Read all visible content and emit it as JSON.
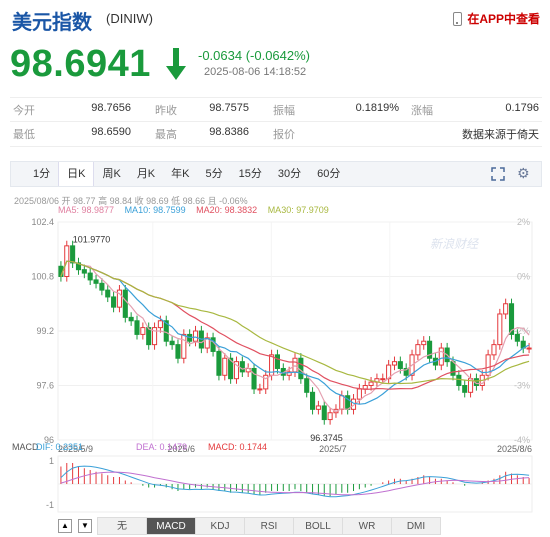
{
  "header": {
    "title": "美元指数",
    "code": "(DINIW)",
    "app_link": "在APP中查看",
    "price": "98.6941",
    "change": "-0.0634 (-0.0642%)",
    "timestamp": "2025-08-06 14:18:52"
  },
  "stats": [
    [
      {
        "label": "今开",
        "value": "98.7656"
      },
      {
        "label": "昨收",
        "value": "98.7575"
      },
      {
        "label": "振幅",
        "value": "0.1819%"
      },
      {
        "label": "涨幅",
        "value": "0.1796"
      }
    ],
    [
      {
        "label": "最低",
        "value": "98.6590"
      },
      {
        "label": "最高",
        "value": "98.8386"
      },
      {
        "label": "报价",
        "value": ""
      },
      {
        "label": "",
        "value": "数据来源于倚天"
      }
    ]
  ],
  "tabs": [
    "1分",
    "日K",
    "周K",
    "月K",
    "年K",
    "5分",
    "15分",
    "30分",
    "60分"
  ],
  "active_tab": "日K",
  "chart_info": {
    "line1": "2025/08/06 开 98.77 高 98.84 收 98.69 低 98.66 且 -0.06%",
    "ma5": "MA5: 98.9877",
    "ma10": "MA10: 98.7599",
    "ma20": "MA20: 98.3832",
    "ma30": "MA30: 97.9709",
    "watermark": "新浪财经"
  },
  "macd_info": {
    "label": "MACD",
    "dif": "DIF: 0.2351",
    "dea": "DEA: 0.1479",
    "macd": "MACD: 0.1744"
  },
  "bottom_tabs": [
    "无",
    "MACD",
    "KDJ",
    "RSI",
    "BOLL",
    "WR",
    "DMI"
  ],
  "active_bottom": "MACD",
  "colors": {
    "up": "#e4393c",
    "down": "#1a9a3c",
    "ma5": "#e4a0b0",
    "ma10": "#3aa0d8",
    "ma20": "#e05060",
    "ma30": "#a8b840"
  },
  "chart_data": {
    "type": "candlestick",
    "y_ticks": [
      "102.4",
      "100.8",
      "99.2",
      "97.6",
      "96"
    ],
    "y_right_ticks": [
      "2%",
      "0%",
      "-2%",
      "-3%",
      "-4%"
    ],
    "x_labels": [
      "2025/5/9",
      "2025/6",
      "2025/7",
      "2025/8/6"
    ],
    "annotations": [
      "101.9770",
      "96.3745"
    ],
    "ylim": [
      96,
      102.4
    ],
    "close": [
      100.8,
      101.7,
      101.2,
      101.0,
      100.9,
      100.7,
      100.6,
      100.4,
      100.2,
      99.9,
      100.4,
      99.6,
      99.5,
      99.1,
      99.3,
      98.8,
      99.3,
      99.5,
      98.9,
      98.8,
      98.4,
      99.1,
      98.9,
      99.2,
      98.7,
      99.0,
      98.6,
      97.9,
      98.4,
      97.8,
      98.3,
      98.0,
      98.1,
      97.5,
      97.5,
      97.9,
      98.5,
      98.1,
      97.9,
      98.0,
      98.4,
      97.8,
      97.4,
      96.9,
      97.0,
      96.6,
      96.8,
      96.9,
      97.3,
      96.9,
      97.2,
      97.5,
      97.6,
      97.7,
      97.8,
      97.8,
      98.2,
      98.3,
      98.1,
      97.9,
      98.5,
      98.8,
      98.9,
      98.4,
      98.2,
      98.7,
      98.3,
      97.9,
      97.6,
      97.4,
      97.8,
      97.6,
      97.9,
      98.5,
      98.8,
      99.7,
      100.0,
      99.1,
      98.9,
      98.7,
      98.7
    ],
    "macd_hist": [
      0.5,
      0.6,
      0.6,
      0.5,
      0.45,
      0.4,
      0.35,
      0.3,
      0.25,
      0.2,
      0.2,
      0.1,
      0.05,
      0,
      -0.05,
      -0.1,
      -0.1,
      -0.05,
      -0.1,
      -0.15,
      -0.2,
      -0.15,
      -0.15,
      -0.1,
      -0.15,
      -0.1,
      -0.15,
      -0.2,
      -0.2,
      -0.25,
      -0.2,
      -0.25,
      -0.25,
      -0.3,
      -0.3,
      -0.25,
      -0.2,
      -0.2,
      -0.2,
      -0.2,
      -0.15,
      -0.2,
      -0.25,
      -0.3,
      -0.3,
      -0.35,
      -0.35,
      -0.3,
      -0.25,
      -0.25,
      -0.2,
      -0.15,
      -0.1,
      -0.05,
      0,
      0.05,
      0.1,
      0.15,
      0.15,
      0.1,
      0.15,
      0.2,
      0.25,
      0.2,
      0.15,
      0.15,
      0.1,
      0.05,
      0,
      -0.05,
      0,
      0,
      0.05,
      0.1,
      0.15,
      0.25,
      0.35,
      0.3,
      0.25,
      0.2,
      0.17
    ]
  }
}
